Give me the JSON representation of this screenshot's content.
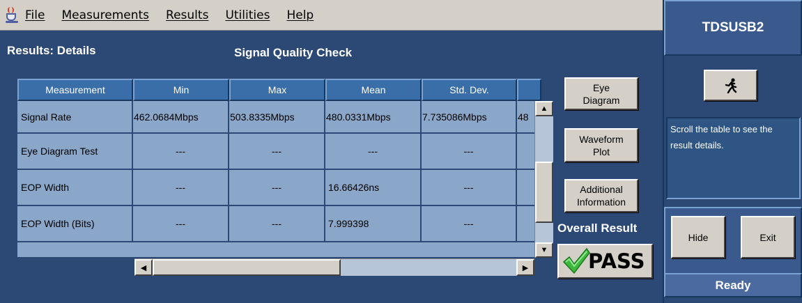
{
  "menu": [
    {
      "key": "F",
      "rest": "ile"
    },
    {
      "key": "M",
      "rest": "easurements"
    },
    {
      "key": "R",
      "rest": "esults"
    },
    {
      "key": "U",
      "rest": "tilities"
    },
    {
      "key": "H",
      "rest": "elp"
    }
  ],
  "header": {
    "results_title": "Results: Details",
    "section_title": "Signal Quality Check"
  },
  "table": {
    "columns": [
      "Measurement",
      "Min",
      "Max",
      "Mean",
      "Std. Dev.",
      ""
    ],
    "rows": [
      {
        "measurement": "Signal Rate",
        "min": "462.0684Mbps",
        "max": "503.8335Mbps",
        "mean": "480.0331Mbps",
        "std_dev": "7.735086Mbps",
        "extra": "48"
      },
      {
        "measurement": "Eye Diagram Test",
        "min": "---",
        "max": "---",
        "mean": "---",
        "std_dev": "---",
        "extra": ""
      },
      {
        "measurement": "EOP Width",
        "min": "---",
        "max": "---",
        "mean": "16.66426ns",
        "std_dev": "---",
        "extra": ""
      },
      {
        "measurement": "EOP Width (Bits)",
        "min": "---",
        "max": "---",
        "mean": "7.999398",
        "std_dev": "---",
        "extra": ""
      }
    ]
  },
  "buttons": {
    "eye_diagram": "Eye\nDiagram",
    "waveform_plot": "Waveform\nPlot",
    "additional_info": "Additional\nInformation",
    "hide": "Hide",
    "exit": "Exit"
  },
  "result": {
    "label": "Overall Result",
    "value": "PASS",
    "color": "#3cb83c"
  },
  "side_panel": {
    "product": "TDSUSB2",
    "message": "Scroll the table to see the result details.",
    "status": "Ready"
  },
  "icons": {
    "app": "java-cup-icon",
    "run": "running-man-icon",
    "check": "check-icon"
  }
}
